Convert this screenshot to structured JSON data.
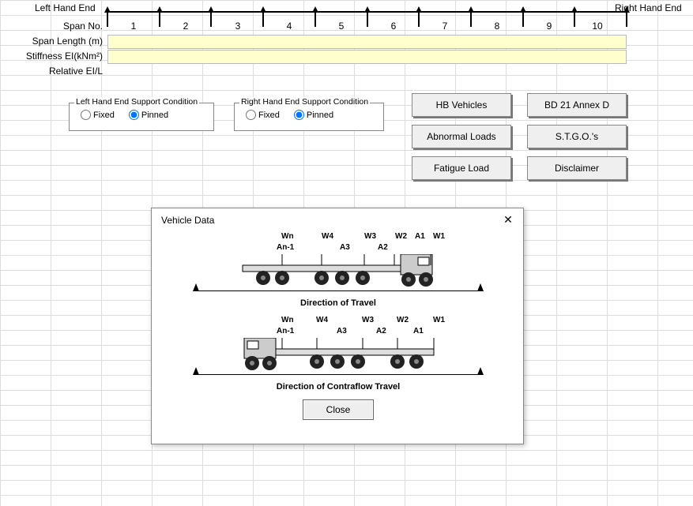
{
  "end_labels": {
    "left": "Left Hand End",
    "right": "Right Hand End"
  },
  "row_labels": {
    "span_no": "Span No.",
    "span_len": "Span Length (m)",
    "stiffness": "Stiffness EI(kNm²)",
    "rel": "Relative EI/L"
  },
  "span_numbers": [
    "1",
    "2",
    "3",
    "4",
    "5",
    "6",
    "7",
    "8",
    "9",
    "10"
  ],
  "left_group": {
    "title": "Left Hand End Support Condition",
    "opt1": "Fixed",
    "opt2": "Pinned",
    "selected": "Pinned"
  },
  "right_group": {
    "title": "Right Hand End Support Condition",
    "opt1": "Fixed",
    "opt2": "Pinned",
    "selected": "Pinned"
  },
  "buttons": {
    "hb": "HB Vehicles",
    "bd21": "BD 21 Annex D",
    "abnormal": "Abnormal Loads",
    "stgo": "S.T.G.O.'s",
    "fatigue": "Fatigue Load",
    "disclaimer": "Disclaimer"
  },
  "dialog": {
    "title": "Vehicle Data",
    "close_x": "✕",
    "direction1": "Direction of Travel",
    "direction2": "Direction of Contraflow Travel",
    "close_btn": "Close",
    "axle_labels": {
      "wn": "Wn",
      "w4": "W4",
      "w3": "W3",
      "w2": "W2",
      "w1": "W1",
      "a1": "A1",
      "a2": "A2",
      "a3": "A3",
      "an1": "An-1"
    },
    "axle_labels2": {
      "wn": "Wn",
      "w4": "W4",
      "w3": "W3",
      "w2": "W2",
      "w1": "W1",
      "a1": "A1",
      "a2": "A2",
      "a3": "A3",
      "an1": "An-1"
    }
  }
}
